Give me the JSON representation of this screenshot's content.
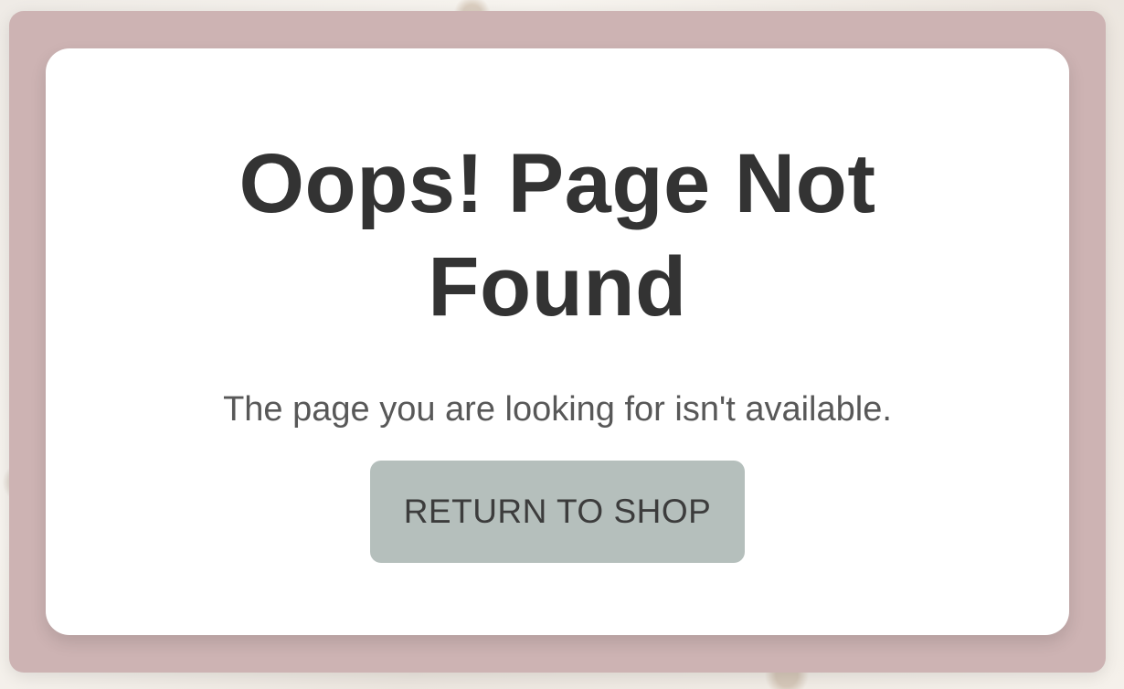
{
  "error_page": {
    "title": "Oops! Page Not Found",
    "message": "The page you are looking for isn't available.",
    "button_label": "RETURN TO SHOP"
  },
  "colors": {
    "frame": "#cdb3b3",
    "card": "#ffffff",
    "title_text": "#333333",
    "message_text": "#585858",
    "button_background": "#b5bfbc",
    "button_text": "#3c3c3c"
  }
}
